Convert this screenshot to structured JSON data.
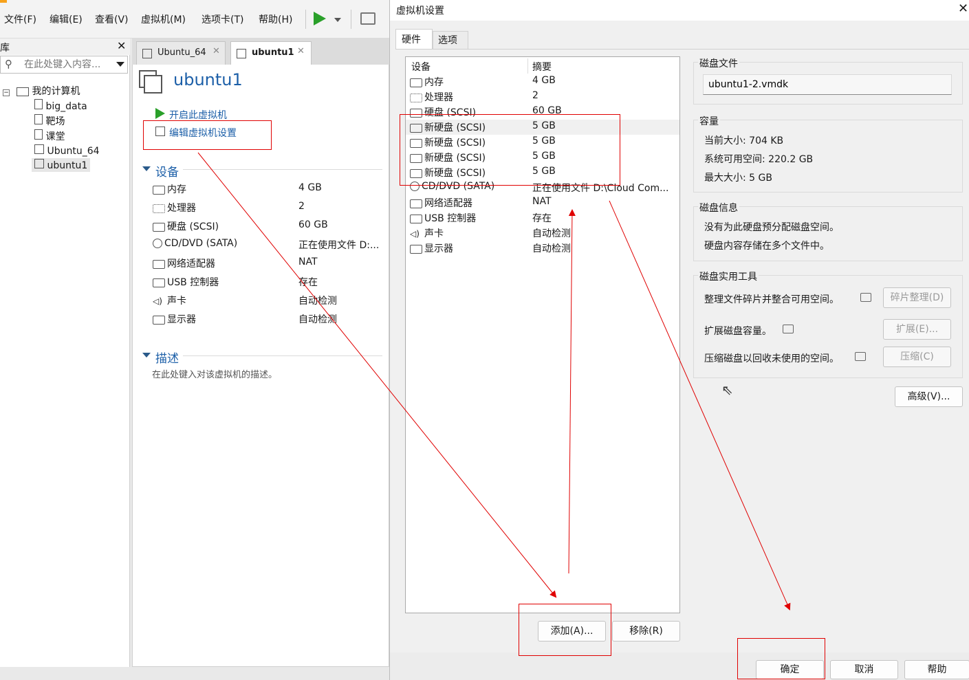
{
  "menu": [
    "文件(F)",
    "编辑(E)",
    "查看(V)",
    "虚拟机(M)",
    "选项卡(T)",
    "帮助(H)"
  ],
  "library": {
    "title": "库",
    "search_placeholder": "在此处键入内容...",
    "root": "我的计算机",
    "items": [
      "big_data",
      "靶场",
      "课堂",
      "Ubuntu_64",
      "ubuntu1"
    ]
  },
  "tabs": [
    "Ubuntu_64",
    "ubuntu1"
  ],
  "vm": {
    "name": "ubuntu1",
    "power_on": "开启此虚拟机",
    "edit_settings": "编辑虚拟机设置",
    "devices_header": "设备",
    "devices": [
      {
        "name": "内存",
        "value": "4 GB"
      },
      {
        "name": "处理器",
        "value": "2"
      },
      {
        "name": "硬盘 (SCSI)",
        "value": "60 GB"
      },
      {
        "name": "CD/DVD (SATA)",
        "value": "正在使用文件 D:..."
      },
      {
        "name": "网络适配器",
        "value": "NAT"
      },
      {
        "name": "USB 控制器",
        "value": "存在"
      },
      {
        "name": "声卡",
        "value": "自动检测"
      },
      {
        "name": "显示器",
        "value": "自动检测"
      }
    ],
    "desc_header": "描述",
    "desc_placeholder": "在此处键入对该虚拟机的描述。"
  },
  "dialog": {
    "title": "虚拟机设置",
    "tabs": [
      "硬件",
      "选项"
    ],
    "col_device": "设备",
    "col_summary": "摘要",
    "hardware": [
      {
        "name": "内存",
        "value": "4 GB"
      },
      {
        "name": "处理器",
        "value": "2"
      },
      {
        "name": "硬盘 (SCSI)",
        "value": "60 GB"
      },
      {
        "name": "新硬盘 (SCSI)",
        "value": "5 GB"
      },
      {
        "name": "新硬盘 (SCSI)",
        "value": "5 GB"
      },
      {
        "name": "新硬盘 (SCSI)",
        "value": "5 GB"
      },
      {
        "name": "新硬盘 (SCSI)",
        "value": "5 GB"
      },
      {
        "name": "CD/DVD (SATA)",
        "value": "正在使用文件 D:\\Cloud Com..."
      },
      {
        "name": "网络适配器",
        "value": "NAT"
      },
      {
        "name": "USB 控制器",
        "value": "存在"
      },
      {
        "name": "声卡",
        "value": "自动检测"
      },
      {
        "name": "显示器",
        "value": "自动检测"
      }
    ],
    "add_button": "添加(A)...",
    "remove_button": "移除(R)",
    "disk_file_label": "磁盘文件",
    "disk_file": "ubuntu1-2.vmdk",
    "capacity_label": "容量",
    "current_size": "当前大小: 704 KB",
    "free_space": "系统可用空间: 220.2 GB",
    "max_size": "最大大小: 5 GB",
    "disk_info_label": "磁盘信息",
    "disk_info_1": "没有为此硬盘预分配磁盘空间。",
    "disk_info_2": "硬盘内容存储在多个文件中。",
    "utilities_label": "磁盘实用工具",
    "defrag_text": "整理文件碎片并整合可用空间。",
    "defrag_button": "碎片整理(D)",
    "expand_text": "扩展磁盘容量。",
    "expand_button": "扩展(E)...",
    "compact_text": "压缩磁盘以回收未使用的空间。",
    "compact_button": "压缩(C)",
    "advanced_button": "高级(V)...",
    "ok_button": "确定",
    "cancel_button": "取消",
    "help_button": "帮助"
  },
  "annotation_color": "#e00000"
}
